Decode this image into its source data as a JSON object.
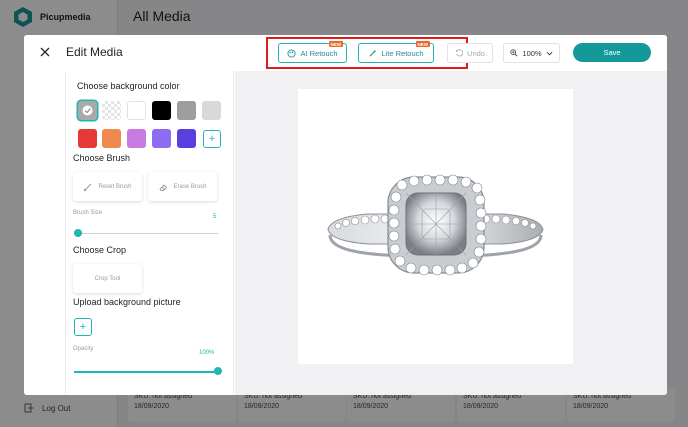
{
  "background_app": {
    "brand": "Picupmedia",
    "page_title": "All Media",
    "logout_label": "Log Out",
    "cards": [
      {
        "sku": "SKU: not assigned",
        "date": "18/09/2020"
      },
      {
        "sku": "SKU: not assigned",
        "date": "18/09/2020"
      },
      {
        "sku": "SKU: not assigned",
        "date": "18/09/2020"
      },
      {
        "sku": "SKU: not assigned",
        "date": "18/09/2020"
      },
      {
        "sku": "SKU: not assigned",
        "date": "18/09/2020"
      }
    ]
  },
  "modal": {
    "title": "Edit Media",
    "ai_retouch_label": "AI Retouch",
    "lite_retouch_label": "Lite Retouch",
    "new_badge": "NEW",
    "undo_label": "Undo",
    "zoom_value": "100%",
    "save_label": "Save"
  },
  "panel": {
    "bg_color_title": "Choose background color",
    "swatches_row1": [
      "#a9a9a9",
      "transparent",
      "#ffffff",
      "#000000",
      "#9e9e9e",
      "#d9d9d9"
    ],
    "swatches_row2": [
      "#e53935",
      "#f0894f",
      "#c77ae0",
      "#8e6df2",
      "#5b3ee0"
    ],
    "brush_title": "Choose Brush",
    "reset_brush_label": "Reset Brush",
    "erase_brush_label": "Erase Brush",
    "brush_size_label": "Brush Size",
    "brush_size_value": "5",
    "brush_size_fraction": 0.03,
    "crop_title": "Choose Crop",
    "crop_tool_label": "Crop Tool",
    "upload_title": "Upload background picture",
    "opacity_label": "Opacity",
    "opacity_value": "100%",
    "opacity_fraction": 1.0
  },
  "colors": {
    "accent": "#14999b",
    "teal_light": "#1fb5b5",
    "badge": "#e96a2a",
    "highlight": "#e01b1b"
  }
}
